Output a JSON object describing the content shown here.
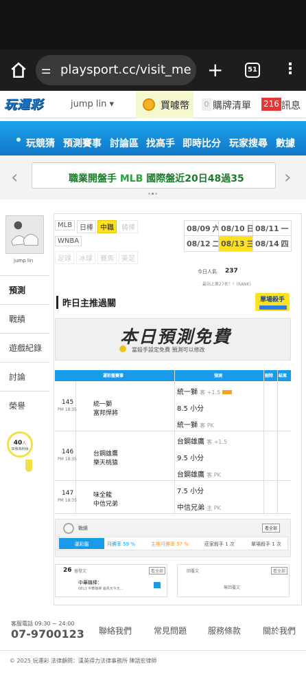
{
  "browser": {
    "url": "playsport.cc/visit_memb",
    "tab_count": "51"
  },
  "topbar": {
    "logo": "玩運彩",
    "user": "jump lin ▾",
    "coin_label": "買噱幣",
    "buy_count": "0",
    "buy_label": "購牌清單",
    "msg_count": "216",
    "msg_label": "訊息"
  },
  "nav": {
    "items": [
      "玩競猜",
      "預測賽事",
      "討論區",
      "找高手",
      "即時比分",
      "玩家搜尋",
      "數據"
    ]
  },
  "banner": {
    "prefix": "職業開盤手 ",
    "highlight": "MLB",
    "suffix": " 國際盤近20日48過35"
  },
  "profile": {
    "name": "jump lin",
    "fans_count": "40",
    "fans_unit": "人",
    "fans_label": "加我為粉絲"
  },
  "sidebar": {
    "items": [
      "預測",
      "戰績",
      "遊戲紀錄",
      "討論",
      "榮譽"
    ]
  },
  "categories": {
    "row1": [
      "MLB",
      "日棒",
      "中職",
      "韓棒"
    ],
    "row2": [
      "WNBA"
    ],
    "row3": [
      "足球",
      "冰球",
      "賽馬",
      "美足"
    ]
  },
  "dates": [
    {
      "d": "08/09",
      "w": "六"
    },
    {
      "d": "08/10",
      "w": "日"
    },
    {
      "d": "08/11",
      "w": "一"
    },
    {
      "d": "08/12",
      "w": "二"
    },
    {
      "d": "08/13",
      "w": "三"
    },
    {
      "d": "08/14",
      "w": "四"
    }
  ],
  "stats": {
    "pop_label": "今日人氣",
    "pop_value": "237",
    "rank": "最站上第27名！！(RANK)",
    "king": "單場殺手"
  },
  "section": {
    "title": "昨日主推過關",
    "ad_title": "本日預測免費",
    "ad_sub": "當殺手設定免費 預測可以修改"
  },
  "table": {
    "headers": [
      "運彩盤賽事",
      "預測",
      "刪除",
      "結果"
    ],
    "games": [
      {
        "no": "145",
        "time": "PM 18:35",
        "away": "統一獅",
        "home": "富邦悍將",
        "picks": [
          {
            "t": "統一獅",
            "n": "客 +1.5"
          },
          {
            "t": "8.5 小分",
            "n": ""
          },
          {
            "t": "統一獅",
            "n": "客 PK"
          }
        ]
      },
      {
        "no": "146",
        "time": "PM 18:35",
        "away": "台鋼雄鷹",
        "home": "樂天桃猿",
        "picks": [
          {
            "t": "台鋼雄鷹",
            "n": "客 +1.5"
          },
          {
            "t": "9.5 小分",
            "n": ""
          },
          {
            "t": "台鋼雄鷹",
            "n": "客 PK"
          }
        ]
      },
      {
        "no": "147",
        "time": "PM 18:35",
        "away": "味全龍",
        "home": "中信兄弟",
        "picks": [
          {
            "t": "7.5 小分",
            "n": ""
          },
          {
            "t": "中信兄弟",
            "n": "主 PK"
          }
        ]
      }
    ]
  },
  "record": {
    "label": "戰績",
    "all": "看全部",
    "items": [
      "運彩盤",
      "月勝率 59 %",
      "主推月勝率 57 %",
      "莊家殺手 1 次",
      "單場殺手 1 次"
    ]
  },
  "boards": {
    "count": "26",
    "left_title": "留發文",
    "all": "看全部",
    "post": "中華職棒：",
    "post_sub": "0813 中華職棒 龜馬天今天...",
    "right_title": "回覆文",
    "empty": "無回覆文"
  },
  "footer": {
    "tel_label": "客服電話 09:30 ~ 24:00",
    "tel": "07-9700123",
    "links": [
      "聯絡我們",
      "常見問題",
      "服務條款",
      "關於我們"
    ],
    "copyright": "© 2025 玩運彩 法律顧問：漢英得力法律事務所 陳語宏律師"
  }
}
